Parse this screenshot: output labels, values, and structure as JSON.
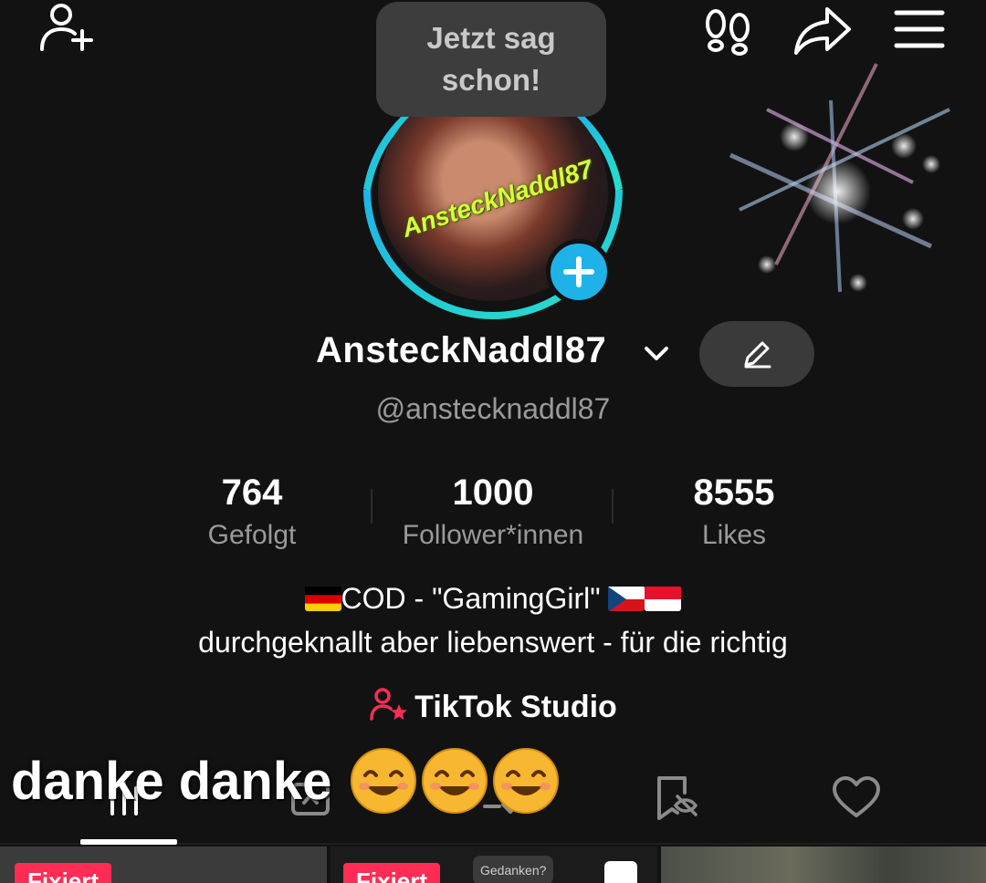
{
  "top_bar": {
    "add_friend_icon": "person-add-icon",
    "footprint_icon": "footprint-icon",
    "share_icon": "share-arrow-icon",
    "menu_icon": "hamburger-menu-icon"
  },
  "bubble": {
    "text": "Jetzt sag\nschon!"
  },
  "avatar": {
    "overlay_text": "AnsteckNaddl87"
  },
  "profile": {
    "display_name": "AnsteckNaddl87",
    "handle": "@anstecknaddl87"
  },
  "stats": [
    {
      "value": "764",
      "label": "Gefolgt"
    },
    {
      "value": "1000",
      "label": "Follower*innen"
    },
    {
      "value": "8555",
      "label": "Likes"
    }
  ],
  "bio": {
    "line1": "COD - \"GamingGirl\"",
    "line2": "durchgeknallt aber liebenswert - für die richtig"
  },
  "studio": {
    "label": "TikTok Studio"
  },
  "tabs": [
    {
      "name": "videos",
      "icon": "grid-bars-icon"
    },
    {
      "name": "reposts",
      "icon": "repost-icon"
    },
    {
      "name": "private",
      "icon": "private-icon"
    },
    {
      "name": "saved",
      "icon": "bookmark-hidden-icon"
    },
    {
      "name": "liked",
      "icon": "heart-icon"
    }
  ],
  "caption": {
    "text": "danke danke"
  },
  "grid": {
    "pin_label": "Fixiert",
    "gedanken": "Gedanken?"
  },
  "colors": {
    "background": "#121212",
    "accent_blue": "#1fb2e8",
    "accent_red": "#fe2c55",
    "muted_text": "#9a9a9a"
  }
}
